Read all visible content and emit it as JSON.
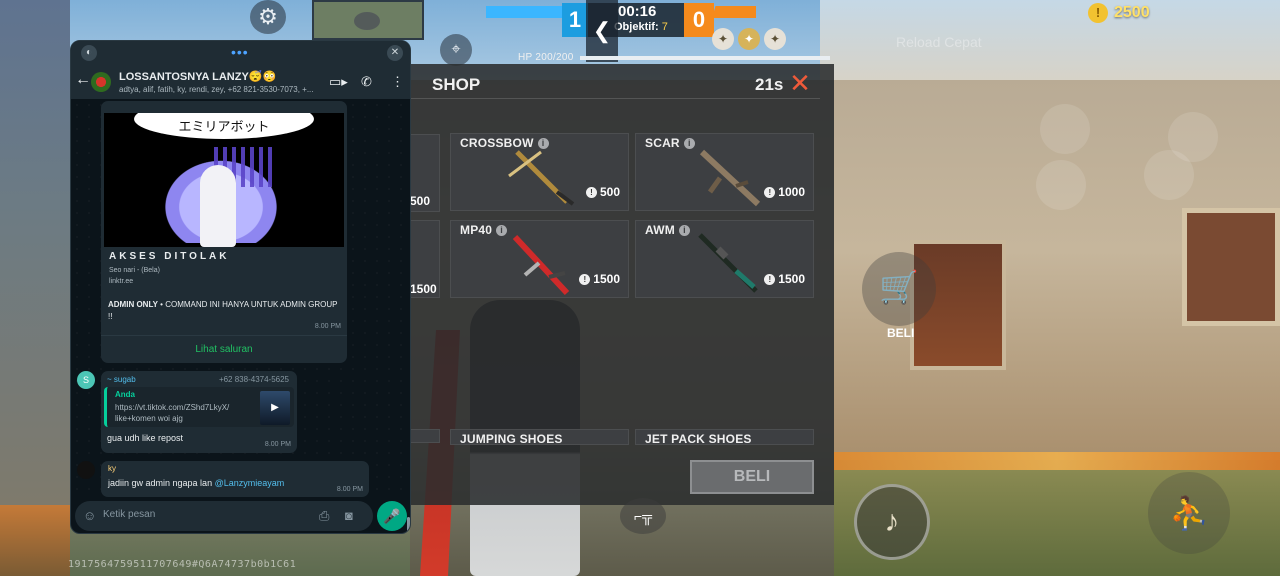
{
  "hud": {
    "score_blue": "1",
    "score_orange": "0",
    "timer": "00:16",
    "objective_label": "Objektif:",
    "objective_value": "7",
    "hp": "HP 200/200",
    "coins": "2500",
    "faded_top": "Reload Cepat"
  },
  "shop": {
    "title": "SHOP",
    "timer": "21s",
    "buy_label": "BELI",
    "partial_prices": [
      "500",
      "1500"
    ],
    "items": [
      {
        "name": "CROSSBOW",
        "price": "500"
      },
      {
        "name": "SCAR",
        "price": "1000"
      },
      {
        "name": "MP40",
        "price": "1500"
      },
      {
        "name": "AWM",
        "price": "1500"
      },
      {
        "name": "JUMPING SHOES",
        "price": ""
      },
      {
        "name": "JET PACK SHOES",
        "price": ""
      }
    ]
  },
  "controls": {
    "cart_label": "BELI"
  },
  "watermark": "191756475951170764​9#Q6A74737b0b1C61",
  "whatsapp": {
    "chat_title": "LOSSANTOSNYA LANZY😴😳",
    "chat_subtitle": "adtya, alif, fatih, ky, rendi, zey, +62 821-3530-7073, +...",
    "card": {
      "banner": "エミリアボット",
      "title": "AKSES DITOLAK",
      "line1": "Seo nari - (Bela)",
      "line2": "linktr.ee",
      "admin_bold": "ADMIN ONLY",
      "admin_text": "• COMMAND INI HANYA UNTUK ADMIN GROUP !!",
      "time": "8.00 PM",
      "link": "Lihat saluran"
    },
    "msg2": {
      "avatar": "S",
      "sender": "~ sugab",
      "phone": "+62 838-4374-5625",
      "quote_name": "Anda",
      "quote_text": "https://vt.tiktok.com/ZShd7LkyX/ like+komen woi ajg",
      "text": "gua udh like repost",
      "time": "8.00 PM"
    },
    "msg3": {
      "sender": "ky",
      "text": "jadiin gw admin ngapa lan",
      "mention": "@Lanzymieayam",
      "time": "8.00 PM"
    },
    "input_placeholder": "Ketik pesan"
  }
}
